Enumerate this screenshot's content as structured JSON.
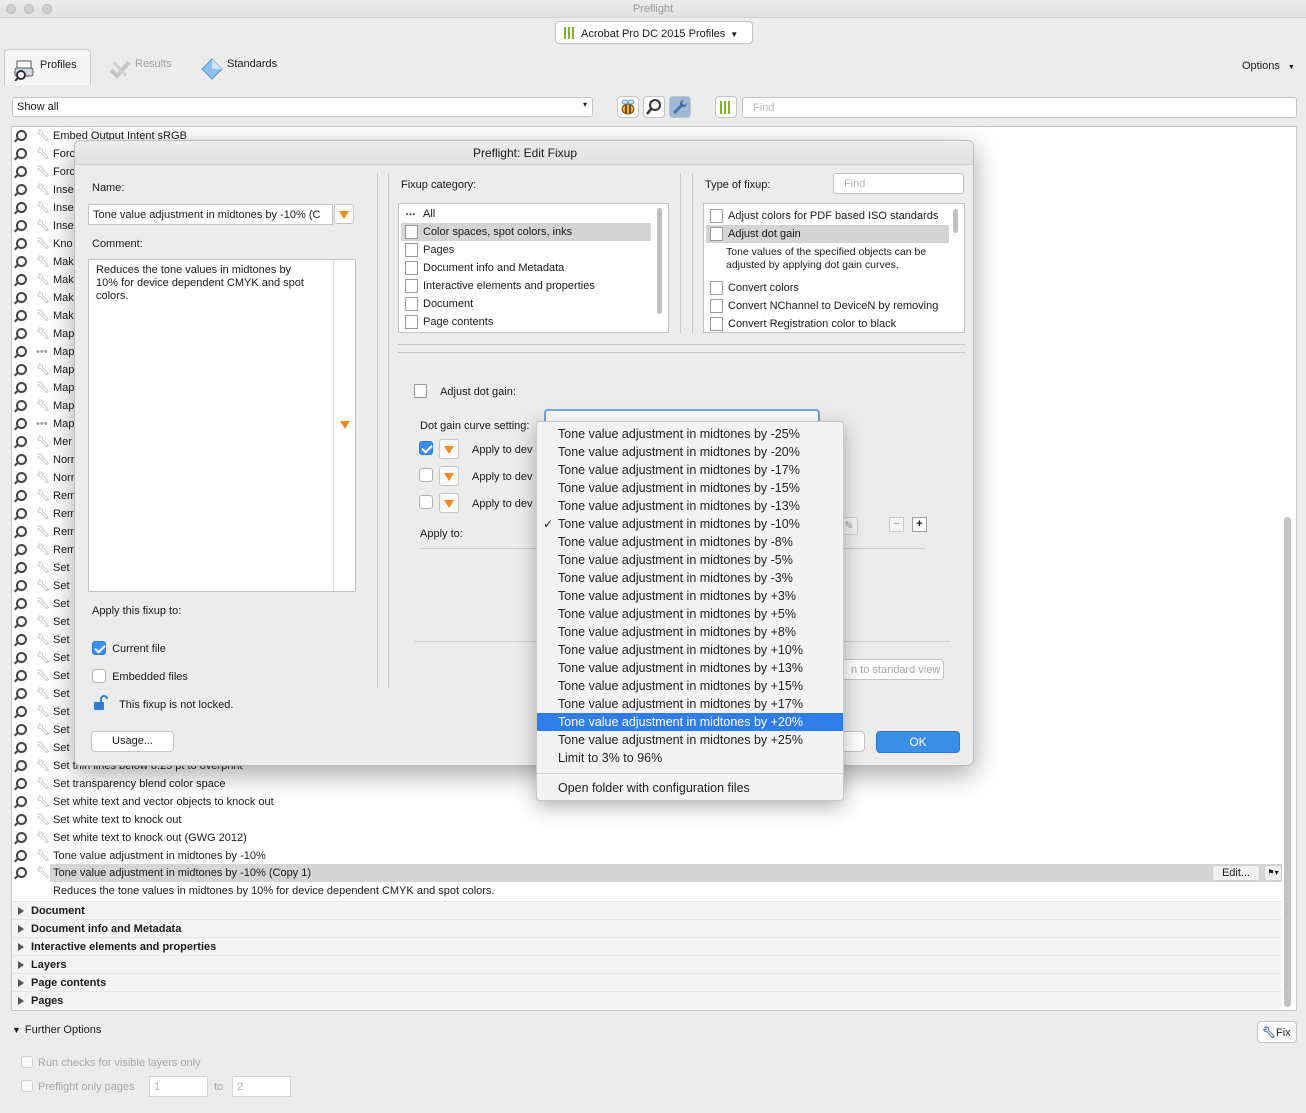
{
  "window": {
    "title": "Preflight"
  },
  "profiles_select": {
    "label": "Acrobat Pro DC 2015 Profiles"
  },
  "tabs": [
    {
      "label": "Profiles"
    },
    {
      "label": "Results"
    },
    {
      "label": "Standards"
    }
  ],
  "options_label": "Options",
  "filter": {
    "value": "Show all"
  },
  "find": {
    "placeholder": "Find"
  },
  "list": {
    "rows": [
      "Embed Output Intent sRGB",
      "Forc",
      "Forc",
      "Inse",
      "Inse",
      "Inse",
      "Kno",
      "Mak",
      "Mak",
      "Mak",
      "Mak",
      "Map",
      "Map",
      "Map",
      "Map",
      "Map",
      "Map",
      "Mer",
      "Norr",
      "Norr",
      "Rem",
      "Rem",
      "Rem",
      "Rem",
      "Set",
      "Set",
      "Set",
      "Set",
      "Set",
      "Set",
      "Set",
      "Set",
      "Set",
      "Set",
      "Set",
      "Set thin lines below 0.25 pt to overprint",
      "Set transparency blend color space",
      "Set white text and vector objects to knock out",
      "Set white text to knock out",
      "Set white text to knock out (GWG 2012)",
      "Tone value adjustment in midtones by -10%"
    ],
    "selected_row": "Tone value adjustment in midtones by -10% (Copy 1)",
    "selected_description": "Reduces the tone values in midtones by 10% for device dependent CMYK and spot colors.",
    "edit_button": "Edit...",
    "groups": [
      "Document",
      "Document info and Metadata",
      "Interactive elements and properties",
      "Layers",
      "Page contents",
      "Pages"
    ]
  },
  "further_options": {
    "label": "Further Options",
    "run_checks": "Run checks for visible layers only",
    "preflight_pages": "Preflight only pages",
    "from_page": "1",
    "to_label": "to",
    "to_page": "2",
    "fix_button": "Fix"
  },
  "dialog": {
    "title": "Preflight: Edit Fixup",
    "name_label": "Name:",
    "name_value": "Tone value adjustment in midtones by -10% (C",
    "comment_label": "Comment:",
    "comment_value": "Reduces the tone values in midtones by 10% for device dependent CMYK and spot colors.",
    "apply_label": "Apply this fixup to:",
    "current_file": "Current file",
    "embedded_files": "Embedded files",
    "lock_text": "This fixup is not locked.",
    "usage_button": "Usage...",
    "category_label": "Fixup category:",
    "categories": [
      "All",
      "Color spaces, spot colors, inks",
      "Pages",
      "Document info and Metadata",
      "Interactive elements and properties",
      "Document",
      "Page contents"
    ],
    "type_label": "Type of fixup:",
    "type_find_placeholder": "Find",
    "types": [
      "Adjust colors for PDF based ISO standards",
      "Adjust dot gain",
      "Convert colors",
      "Convert NChannel to DeviceN by removing",
      "Convert Registration color to black"
    ],
    "type_description": "Tone values of the specified objects can be adjusted by applying dot gain curves.",
    "adjust_title": "Adjust dot gain:",
    "curve_label": "Dot gain curve setting:",
    "apply_rows": [
      "Apply to dev",
      "Apply to dev",
      "Apply to dev"
    ],
    "apply_to_label": "Apply to:",
    "standard_view": "n to standard view",
    "ok_button": "OK"
  },
  "menu": {
    "items": [
      "Tone value adjustment in midtones by -25%",
      "Tone value adjustment in midtones by -20%",
      "Tone value adjustment in midtones by -17%",
      "Tone value adjustment in midtones by -15%",
      "Tone value adjustment in midtones by -13%",
      "Tone value adjustment in midtones by -10%",
      "Tone value adjustment in midtones by -8%",
      "Tone value adjustment in midtones by -5%",
      "Tone value adjustment in midtones by -3%",
      "Tone value adjustment in midtones by +3%",
      "Tone value adjustment in midtones by +5%",
      "Tone value adjustment in midtones by +8%",
      "Tone value adjustment in midtones by +10%",
      "Tone value adjustment in midtones by +13%",
      "Tone value adjustment in midtones by +15%",
      "Tone value adjustment in midtones by +17%",
      "Tone value adjustment in midtones by +20%",
      "Tone value adjustment in midtones by +25%",
      "Limit to 3% to 96%"
    ],
    "checked": "Tone value adjustment in midtones by -10%",
    "highlighted": "Tone value adjustment in midtones by +20%",
    "footer": "Open folder with configuration files"
  },
  "colors": {
    "accent": "#2f7dea",
    "ok": "#3a8ee6",
    "orange": "#f08c1e",
    "brand_green": "#7fb427"
  }
}
